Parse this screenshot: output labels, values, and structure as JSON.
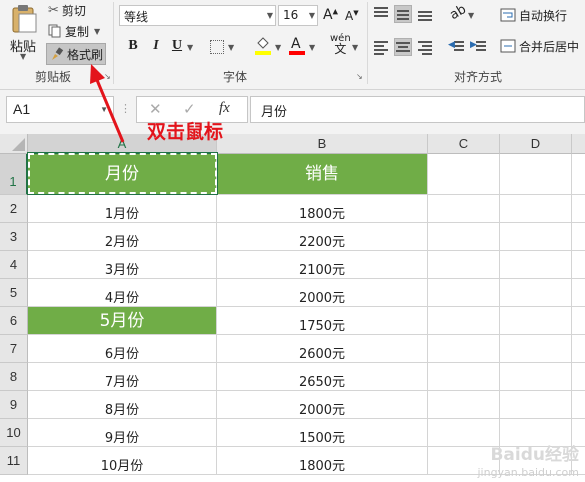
{
  "ribbon": {
    "clipboard": {
      "paste_label": "粘贴",
      "cut_label": "剪切",
      "copy_label": "复制",
      "format_painter_label": "格式刷",
      "group_label": "剪贴板"
    },
    "font": {
      "font_name": "等线",
      "font_size": "16",
      "bold": "B",
      "italic": "I",
      "underline": "U",
      "group_label": "字体",
      "highlight_color": "#ffff00",
      "font_color": "#ff0000"
    },
    "alignment": {
      "wrap_text_label": "自动换行",
      "merge_center_label": "合并后居中",
      "group_label": "对齐方式"
    }
  },
  "formula_bar": {
    "name_box": "A1",
    "fx_label": "fx",
    "formula_value": "月份"
  },
  "grid": {
    "columns": [
      "A",
      "B",
      "C",
      "D"
    ],
    "rows": [
      {
        "num": "1",
        "a": "月份",
        "b": "销售"
      },
      {
        "num": "2",
        "a": "1月份",
        "b": "1800元"
      },
      {
        "num": "3",
        "a": "2月份",
        "b": "2200元"
      },
      {
        "num": "4",
        "a": "3月份",
        "b": "2100元"
      },
      {
        "num": "5",
        "a": "4月份",
        "b": "2000元"
      },
      {
        "num": "6",
        "a": "5月份",
        "b": "1750元"
      },
      {
        "num": "7",
        "a": "6月份",
        "b": "2600元"
      },
      {
        "num": "8",
        "a": "7月份",
        "b": "2650元"
      },
      {
        "num": "9",
        "a": "8月份",
        "b": "2000元"
      },
      {
        "num": "10",
        "a": "9月份",
        "b": "1500元"
      },
      {
        "num": "11",
        "a": "10月份",
        "b": "1800元"
      }
    ],
    "highlight_color": "#70ad47"
  },
  "annotation": {
    "text": "双击鼠标",
    "color": "#e3141b"
  },
  "watermark": {
    "line1": "Baidu经验",
    "line2": "jingyan.baidu.com"
  }
}
